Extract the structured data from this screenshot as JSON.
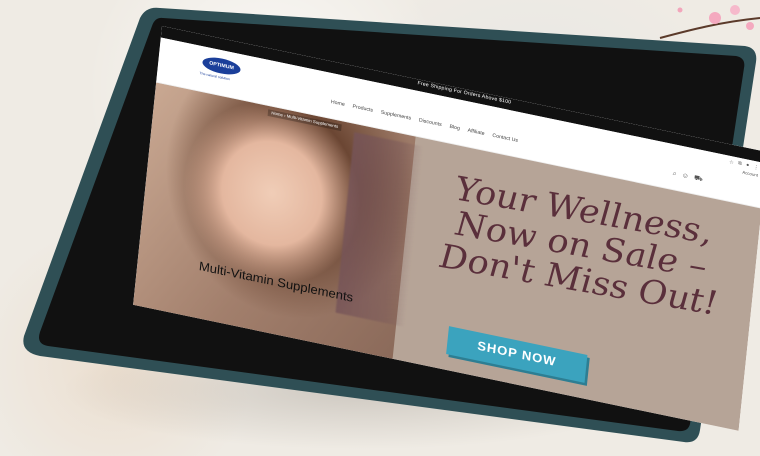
{
  "announcement": "Free Shipping For Orders Above $100",
  "logo": {
    "text": "OPTIMUM",
    "tagline": "The natural solution"
  },
  "nav": [
    "Home",
    "Products",
    "Supplements",
    "Discounts",
    "Blog",
    "Affiliate",
    "Contact Us"
  ],
  "account_label": "Account",
  "breadcrumb": "Home › Multi-Vitamin Supplements",
  "hero": {
    "headline_lines": [
      "Your Wellness,",
      "Now on Sale –",
      "Don't Miss Out!"
    ],
    "caption": "Multi-Vitamin Supplements",
    "cta": "SHOP NOW"
  },
  "icons": {
    "header": [
      "search-icon",
      "user-icon",
      "cart-icon"
    ],
    "browser": [
      "star-icon",
      "extensions-icon",
      "profile-icon",
      "menu-icon"
    ]
  },
  "colors": {
    "accent": "#3ba3be",
    "headline": "#5a2f3b",
    "hero_bg": "#b6a497"
  }
}
